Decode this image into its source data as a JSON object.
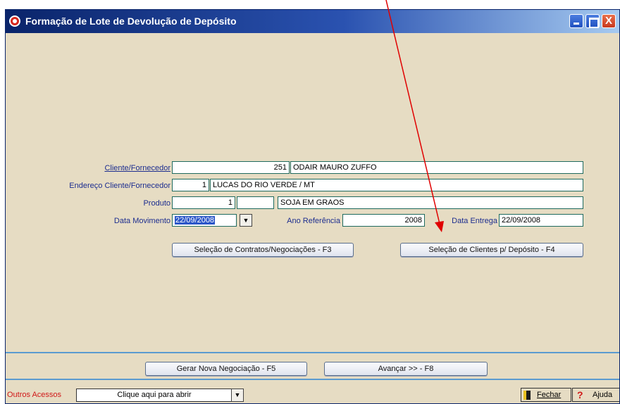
{
  "window": {
    "title": "Formação de Lote de Devolução de Depósito",
    "close_glyph": "X"
  },
  "form": {
    "cliente_label": "Cliente/Fornecedor",
    "cliente_codigo": "251",
    "cliente_nome": "ODAIR MAURO ZUFFO",
    "endereco_label": "Endereço Cliente/Fornecedor",
    "endereco_codigo": "1",
    "endereco_desc": "LUCAS DO RIO VERDE / MT",
    "produto_label": "Produto",
    "produto_codigo": "1",
    "produto_extra": "",
    "produto_desc": "SOJA EM GRAOS",
    "data_mov_label": "Data Movimento",
    "data_mov_value": "22/09/2008",
    "ano_ref_label": "Ano Referência",
    "ano_ref_value": "2008",
    "data_entrega_label": "Data Entrega",
    "data_entrega_value": "22/09/2008"
  },
  "buttons": {
    "contratos": "Seleção de Contratos/Negociações - F3",
    "clientes_deposito": "Seleção de Clientes p/ Depósito - F4",
    "gerar": "Gerar Nova Negociação - F5",
    "avancar": "Avançar >> - F8"
  },
  "status": {
    "outros_label": "Outros Acessos",
    "outros_value": "Clique aqui para abrir",
    "fechar": "Fechar",
    "ajuda": "Ajuda"
  },
  "icons": {
    "app": "app-icon",
    "dropdown": "chevron-down-icon",
    "exit": "exit-door-icon",
    "help": "question-icon"
  },
  "colors": {
    "window_bg": "#e6dcc3",
    "title_start": "#0a246a",
    "label": "#1c2d8f",
    "alert": "#d01818",
    "annotation_arrow": "#e00000"
  }
}
